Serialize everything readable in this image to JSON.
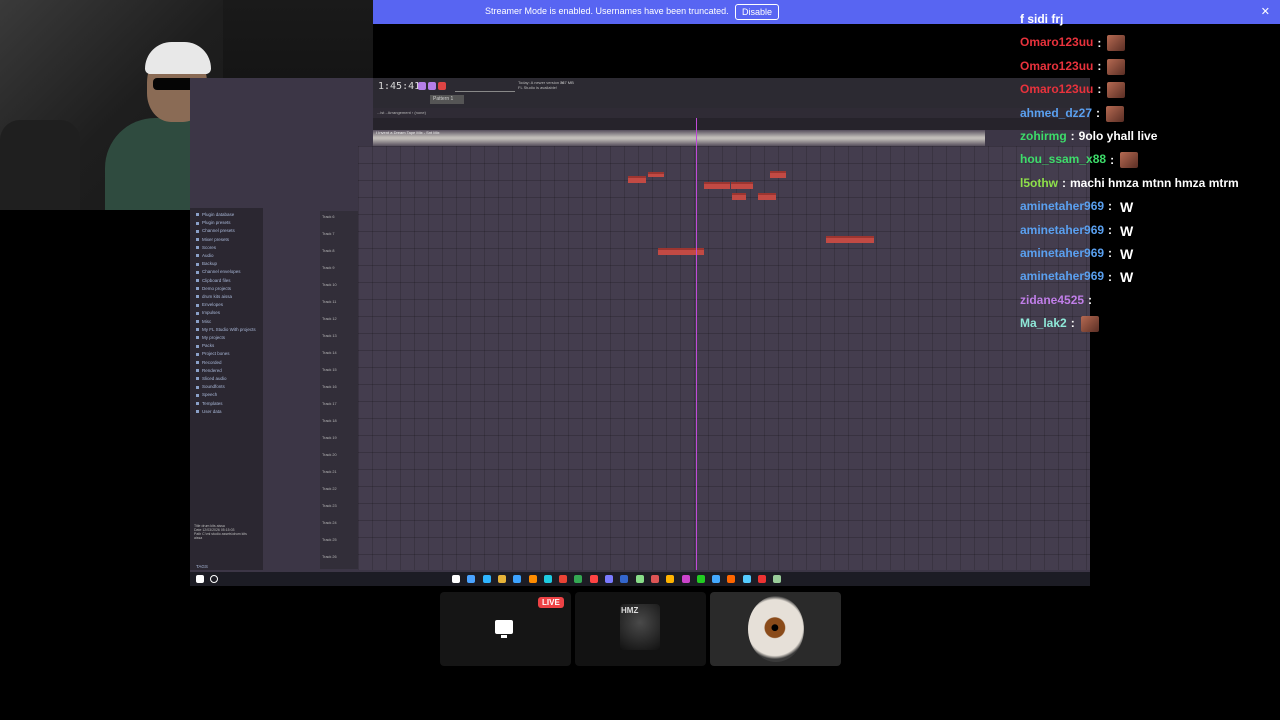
{
  "banner": {
    "text": "Streamer Mode is enabled. Usernames have been truncated.",
    "button_label": "Disable",
    "close_glyph": "✕",
    "color": "#5865f2"
  },
  "fl": {
    "time": "1:45:41",
    "pattern": "Pattern 1",
    "news": "Today: A newer version of FL Studio is available!",
    "cpu": "767 MB",
    "breadcrumb": "...ist - Arrangement › (none)",
    "audio_label": "I Invent a Dream Tape Mix - Snt Mix",
    "browser_items": [
      "Plugin database",
      "Plugin presets",
      "Channel presets",
      "Mixer presets",
      "Scores",
      "Audio",
      "Backup",
      "Channel envelopes",
      "Clipboard files",
      "Demo projects",
      "drum kits aissa",
      "Envelopes",
      "Impulses",
      "Misc",
      "My FL Studio With projects",
      "My projects",
      "Packs",
      "Project bones",
      "Recorded",
      "Rendered",
      "Sliced audio",
      "Soundfonts",
      "Speech",
      "Templates",
      "User data"
    ],
    "browser_info": [
      "Title   drum kits aissa",
      "Date    12/03/2026 05:15:03",
      "Path    C:\\ml studio assets\\drum kits",
      "aissa"
    ],
    "tracks": [
      "Track 6",
      "Track 7",
      "Track 8",
      "Track 9",
      "Track 10",
      "Track 11",
      "Track 12",
      "Track 13",
      "Track 14",
      "Track 15",
      "Track 16",
      "Track 17",
      "Track 18",
      "Track 19",
      "Track 20",
      "Track 21",
      "Track 22",
      "Track 23",
      "Track 24",
      "Track 25",
      "Track 26"
    ],
    "tags_label": "TAGS"
  },
  "chat": [
    {
      "user": "f sidi frj",
      "color": "#ffffff",
      "msg": "",
      "emote": ""
    },
    {
      "user": "Omaro123uu",
      "color": "#e8323c",
      "msg": "",
      "emote": "face-emote"
    },
    {
      "user": "Omaro123uu",
      "color": "#e8323c",
      "msg": "",
      "emote": "face-emote"
    },
    {
      "user": "Omaro123uu",
      "color": "#e8323c",
      "msg": "",
      "emote": "face-emote"
    },
    {
      "user": "ahmed_dz27",
      "color": "#5aa0f0",
      "msg": "",
      "emote": "face-emote"
    },
    {
      "user": "zohirmg",
      "color": "#3ddc6a",
      "msg": "9olo yhall live",
      "emote": ""
    },
    {
      "user": "hou_ssam_x88",
      "color": "#3ddc6a",
      "msg": "",
      "emote": "face-emote"
    },
    {
      "user": "l5othw",
      "color": "#8ee04a",
      "msg": "machi hmza mtnn hmza mtrm",
      "emote": ""
    },
    {
      "user": "aminetaher969",
      "color": "#5aa0f0",
      "msg": "",
      "emote": "W"
    },
    {
      "user": "aminetaher969",
      "color": "#5aa0f0",
      "msg": "",
      "emote": "W"
    },
    {
      "user": "aminetaher969",
      "color": "#5aa0f0",
      "msg": "",
      "emote": "W"
    },
    {
      "user": "aminetaher969",
      "color": "#5aa0f0",
      "msg": "",
      "emote": "W"
    },
    {
      "user": "zidane4525",
      "color": "#c07ee8",
      "msg": "",
      "emote": ""
    },
    {
      "user": "Ma_lak2",
      "color": "#8ee8d8",
      "msg": "",
      "emote": "face-emote"
    }
  ],
  "chat_sep": ":",
  "tiles": {
    "live_label": "LIVE",
    "avatar_text": "HMZ"
  }
}
